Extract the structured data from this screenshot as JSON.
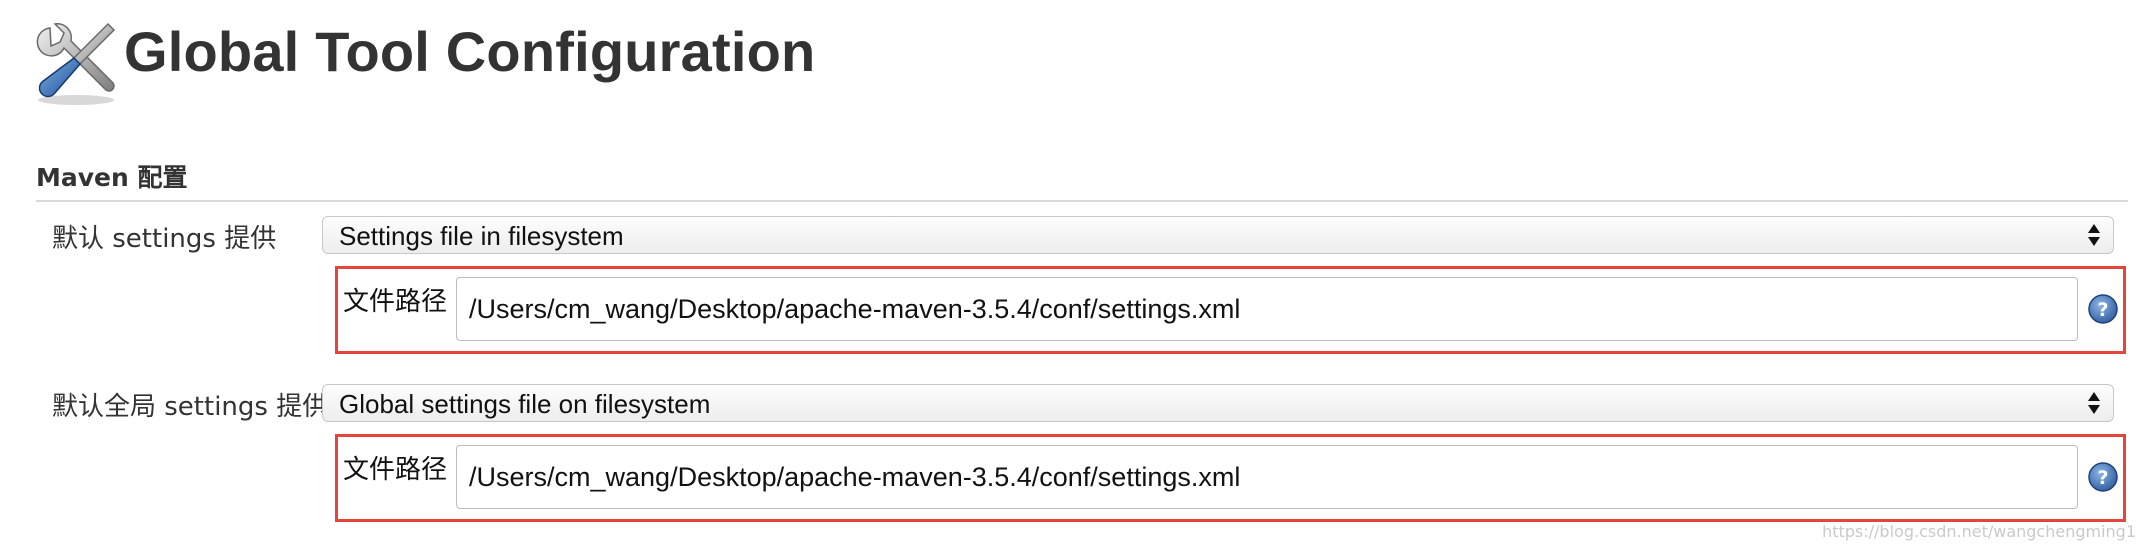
{
  "page": {
    "title": "Global Tool Configuration",
    "icon": "wrench-screwdriver-icon"
  },
  "section": {
    "title": "Maven 配置"
  },
  "settings_provider": {
    "label": "默认 settings 提供",
    "selected": "Settings file in filesystem",
    "file_path_label": "文件路径",
    "file_path_value": "/Users/cm_wang/Desktop/apache-maven-3.5.4/conf/settings.xml"
  },
  "global_settings_provider": {
    "label": "默认全局 settings 提供",
    "selected": "Global settings file on filesystem",
    "file_path_label": "文件路径",
    "file_path_value": "/Users/cm_wang/Desktop/apache-maven-3.5.4/conf/settings.xml"
  },
  "watermark": "https://blog.csdn.net/wangchengming1",
  "colors": {
    "highlight": "#e4453a",
    "help_icon": "#3a6fb0"
  }
}
